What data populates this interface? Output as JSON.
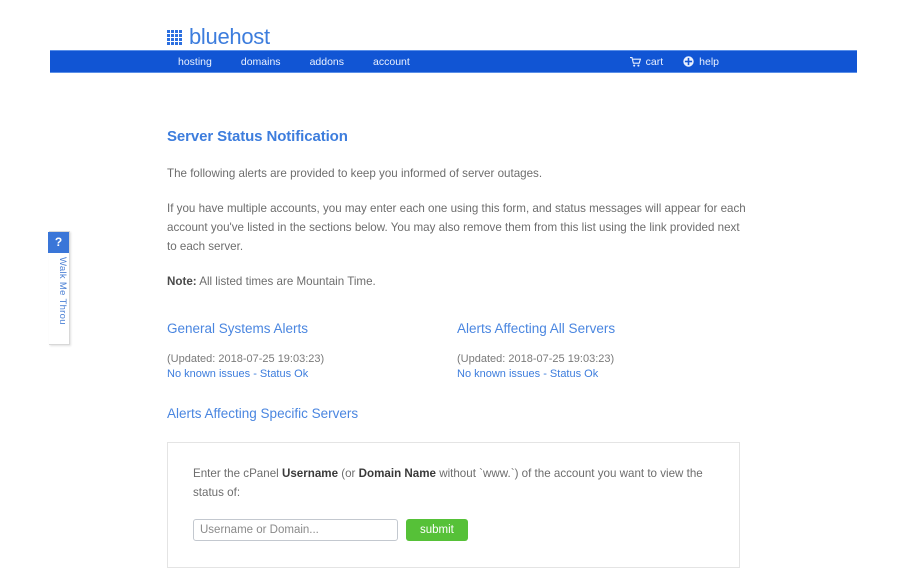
{
  "brand": {
    "logo_text": "bluehost",
    "logo_icon": "grid-icon",
    "accent_blue": "#3d7ddd",
    "nav_blue": "#1155d4",
    "submit_green": "#56c138"
  },
  "nav": {
    "items": [
      {
        "label": "hosting"
      },
      {
        "label": "domains"
      },
      {
        "label": "addons"
      },
      {
        "label": "account"
      }
    ],
    "utilities": [
      {
        "label": "cart",
        "icon": "shopping-cart-icon"
      },
      {
        "label": "help",
        "icon": "help-circle-icon"
      }
    ]
  },
  "walkme": {
    "badge": "?",
    "label": "Walk Me Throu"
  },
  "main": {
    "title": "Server Status Notification",
    "paragraphs": [
      "The following alerts are provided to keep you informed of server outages.",
      "If you have multiple accounts, you may enter each one using this form, and status messages will appear for each account you've listed in the sections below. You may also remove them from this list using the link provided next to each server."
    ],
    "note_label": "Note:",
    "note_text": " All listed times are Mountain Time."
  },
  "alerts": {
    "columns": [
      {
        "title": "General Systems Alerts",
        "updated": "(Updated: 2018-07-25 19:03:23)",
        "status": "No known issues - Status Ok"
      },
      {
        "title": "Alerts Affecting All Servers",
        "updated": "(Updated: 2018-07-25 19:03:23)",
        "status": "No known issues - Status Ok"
      }
    ]
  },
  "specific": {
    "title": "Alerts Affecting Specific Servers",
    "instructions": {
      "part1": "Enter the cPanel ",
      "bold1": "Username",
      "part2": " (or ",
      "bold2": "Domain Name",
      "part3": " without `www.`) of the account you want to view the status of:"
    },
    "input_placeholder": "Username or Domain...",
    "input_value": "",
    "submit_label": "submit"
  }
}
